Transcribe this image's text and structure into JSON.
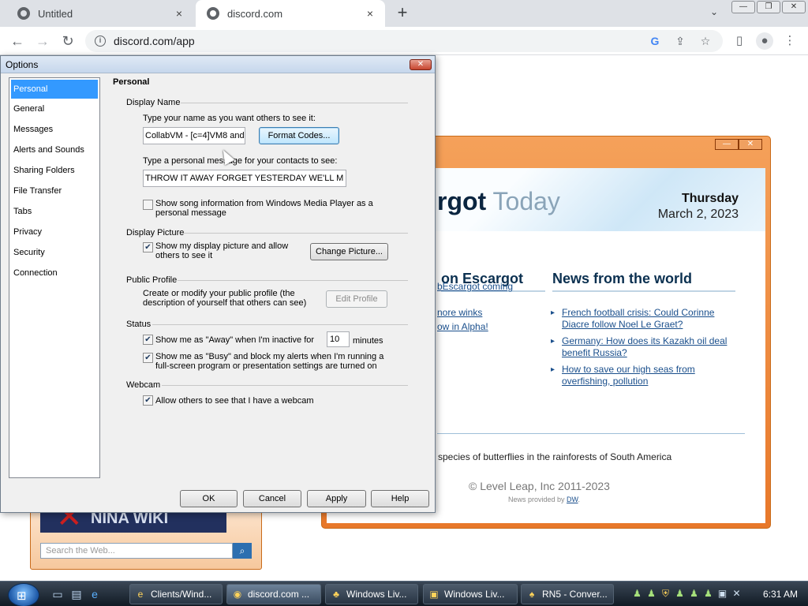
{
  "browser": {
    "tabs": [
      {
        "title": "Untitled",
        "close": "×"
      },
      {
        "title": "discord.com",
        "close": "×"
      }
    ],
    "new_tab": "+",
    "tabs_menu": "⌄",
    "window_buttons": [
      "—",
      "❐",
      "✕"
    ],
    "nav": {
      "back": "←",
      "forward": "→",
      "reload": "↻"
    },
    "url": "discord.com/app"
  },
  "today": {
    "brand_part1": "rgot",
    "brand_part2": "Today",
    "day": "Thursday",
    "date": "March 2, 2023",
    "escargot_heading": "on Escargot",
    "world_heading": "News from the world",
    "escargot_links": [
      "bEscargot coming",
      "nore winks",
      "ow in Alpha!"
    ],
    "world_news": [
      "French football crisis: Could Corinne Diacre follow Noel Le Graet?",
      "Germany: How does its Kazakh oil deal benefit Russia?",
      "How to save our high seas from overfishing, pollution"
    ],
    "fact": "species of butterflies in the rainforests of South America",
    "copyright": "© Level Leap, Inc 2011-2023",
    "provided_prefix": "News provided by ",
    "provided_link": "DW",
    "provided_suffix": "."
  },
  "left_panel": {
    "wiki_text": "NINA WIKI",
    "search_placeholder": "Search the Web..."
  },
  "dialog": {
    "title": "Options",
    "close": "✕",
    "categories": [
      "Personal",
      "General",
      "Messages",
      "Alerts and Sounds",
      "Sharing Folders",
      "File Transfer",
      "Tabs",
      "Privacy",
      "Security",
      "Connection"
    ],
    "page_title": "Personal",
    "display_name": {
      "heading": "Display Name",
      "name_prompt": "Type your name as you want others to see it:",
      "name_value": "CollabVM - [c=4]VM8 and",
      "format_codes": "Format Codes...",
      "psm_prompt": "Type a personal message for your contacts to see:",
      "psm_value": "THROW IT AWAY FORGET YESTERDAY WE'LL M",
      "song_info": "Show song information from Windows Media Player as a personal message"
    },
    "display_picture": {
      "heading": "Display Picture",
      "show_picture": "Show my display picture and allow others to see it",
      "change_picture": "Change Picture..."
    },
    "public_profile": {
      "heading": "Public Profile",
      "description": "Create or modify your public profile (the description of yourself that others can see)",
      "edit_profile": "Edit Profile"
    },
    "status": {
      "heading": "Status",
      "away_prefix": "Show me as \"Away\" when I'm inactive for",
      "away_minutes": "10",
      "away_suffix": "minutes",
      "busy": "Show me as \"Busy\" and block my alerts when I'm running a full-screen program or presentation settings are turned on"
    },
    "webcam": {
      "heading": "Webcam",
      "allow": "Allow others to see that I have a webcam"
    },
    "buttons": {
      "ok": "OK",
      "cancel": "Cancel",
      "apply": "Apply",
      "help": "Help"
    },
    "check_mark": "✔"
  },
  "taskbar": {
    "tasks": [
      "Clients/Wind...",
      "discord.com ...",
      "Windows Liv...",
      "Windows Liv...",
      "RN5 - Conver..."
    ],
    "clock": "6:31 AM"
  }
}
